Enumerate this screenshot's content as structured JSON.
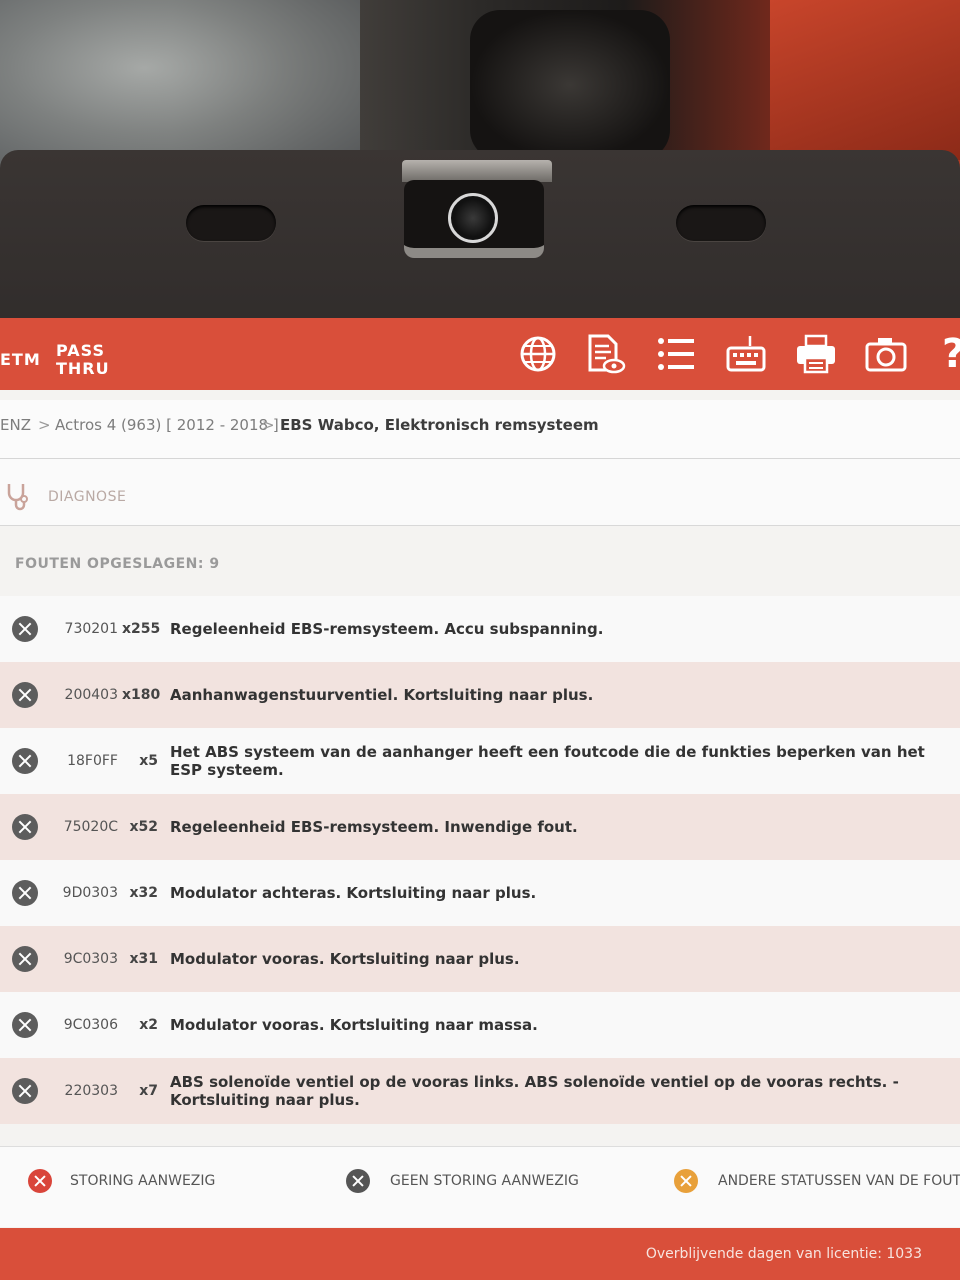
{
  "toolbar": {
    "tab_etm": "ETM",
    "tab_pass_line1": "PASS",
    "tab_pass_line2": "THRU",
    "icons": [
      "globe-icon",
      "document-view-icon",
      "list-icon",
      "keyboard-icon",
      "printer-icon",
      "camera-icon",
      "help-icon"
    ],
    "help_glyph": "?"
  },
  "breadcrumb": {
    "brand_fragment": "ENZ",
    "model": "Actros 4 (963) [ 2012 - 2018 ]",
    "system": "EBS Wabco, Elektronisch remsysteem",
    "separator": ">"
  },
  "section": {
    "label": "DIAGNOSE"
  },
  "faults_header": "FOUTEN OPGESLAGEN: 9",
  "faults": [
    {
      "code": "730201",
      "count": "x255",
      "description": "Regeleenheid EBS-remsysteem. Accu subspanning."
    },
    {
      "code": "200403",
      "count": "x180",
      "description": "Aanhanwagenstuurventiel. Kortsluiting naar plus."
    },
    {
      "code": "18F0FF",
      "count": "x5",
      "description": "Het ABS systeem van de aanhanger heeft een foutcode die de funkties beperken van het ESP systeem."
    },
    {
      "code": "75020C",
      "count": "x52",
      "description": "Regeleenheid EBS-remsysteem. Inwendige fout."
    },
    {
      "code": "9D0303",
      "count": "x32",
      "description": "Modulator achteras. Kortsluiting naar plus."
    },
    {
      "code": "9C0303",
      "count": "x31",
      "description": "Modulator vooras. Kortsluiting naar plus."
    },
    {
      "code": "9C0306",
      "count": "x2",
      "description": "Modulator vooras. Kortsluiting naar massa."
    },
    {
      "code": "220303",
      "count": "x7",
      "description": "ABS solenoïde ventiel op de vooras links. ABS solenoïde ventiel op de vooras rechts. - Kortsluiting naar plus."
    }
  ],
  "legend": {
    "active": "STORING AANWEZIG",
    "inactive": "GEEN STORING AANWEZIG",
    "other": "ANDERE STATUSSEN VAN DE FOUT"
  },
  "footer": {
    "license": "Overblijvende dagen van licentie: 1033"
  },
  "colors": {
    "brand_red": "#d94f3a",
    "active_red": "#d9453a",
    "inactive_gray": "#555555",
    "other_orange": "#e8a03a"
  }
}
